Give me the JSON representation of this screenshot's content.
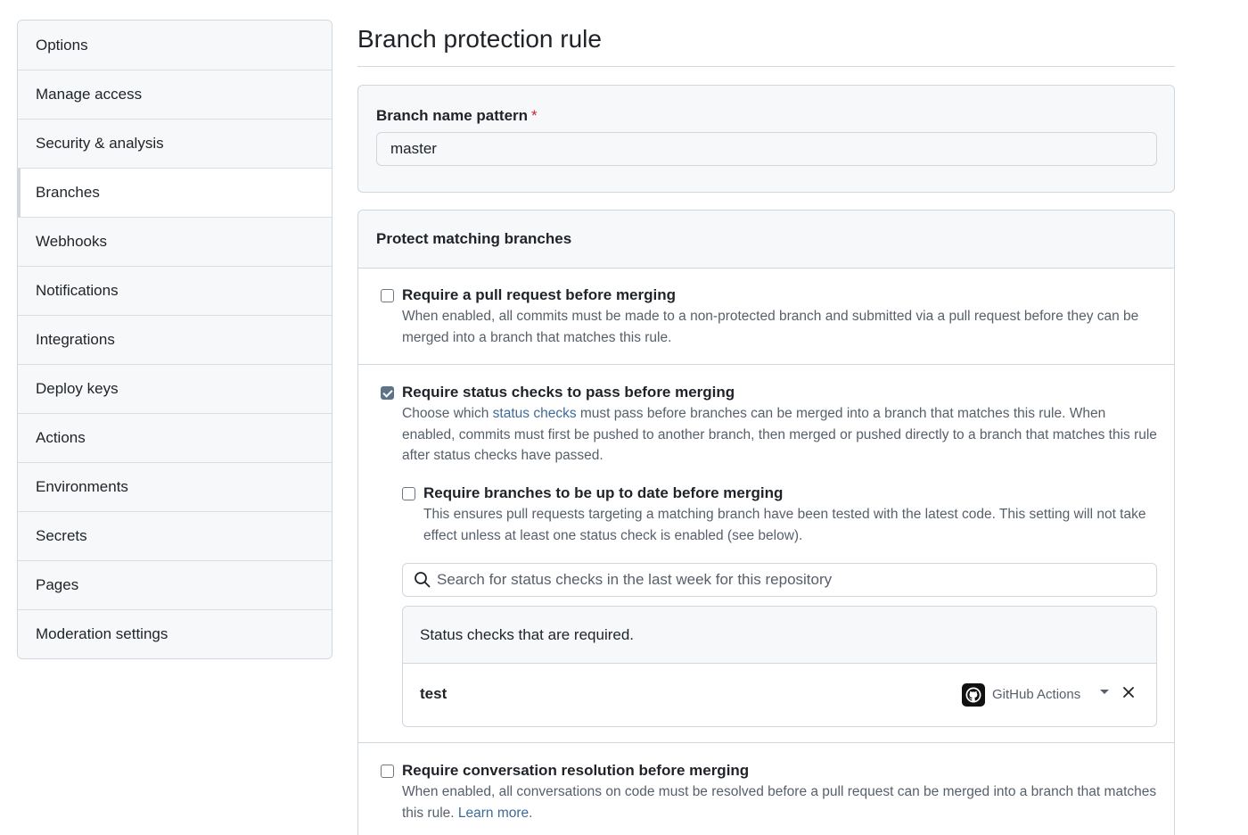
{
  "sidebar": {
    "items": [
      {
        "label": "Options"
      },
      {
        "label": "Manage access"
      },
      {
        "label": "Security & analysis"
      },
      {
        "label": "Branches"
      },
      {
        "label": "Webhooks"
      },
      {
        "label": "Notifications"
      },
      {
        "label": "Integrations"
      },
      {
        "label": "Deploy keys"
      },
      {
        "label": "Actions"
      },
      {
        "label": "Environments"
      },
      {
        "label": "Secrets"
      },
      {
        "label": "Pages"
      },
      {
        "label": "Moderation settings"
      }
    ],
    "active": "Branches"
  },
  "page": {
    "title": "Branch protection rule"
  },
  "pattern": {
    "label": "Branch name pattern",
    "required_mark": "*",
    "value": "master"
  },
  "protect": {
    "heading": "Protect matching branches",
    "rules": {
      "pull_request": {
        "checked": false,
        "title": "Require a pull request before merging",
        "desc": "When enabled, all commits must be made to a non-protected branch and submitted via a pull request before they can be merged into a branch that matches this rule."
      },
      "status_checks": {
        "checked": true,
        "title": "Require status checks to pass before merging",
        "desc_before": "Choose which ",
        "desc_link": "status checks",
        "desc_after": " must pass before branches can be merged into a branch that matches this rule. When enabled, commits must first be pushed to another branch, then merged or pushed directly to a branch that matches this rule after status checks have passed."
      },
      "up_to_date": {
        "checked": false,
        "title": "Require branches to be up to date before merging",
        "desc": "This ensures pull requests targeting a matching branch have been tested with the latest code. This setting will not take effect unless at least one status check is enabled (see below)."
      },
      "conversation": {
        "checked": false,
        "title": "Require conversation resolution before merging",
        "desc_before": "When enabled, all conversations on code must be resolved before a pull request can be merged into a branch that matches this rule. ",
        "desc_link": "Learn more",
        "desc_after": "."
      }
    },
    "search": {
      "placeholder": "Search for status checks in the last week for this repository"
    },
    "required_checks": {
      "heading": "Status checks that are required.",
      "items": [
        {
          "name": "test",
          "app": "GitHub Actions"
        }
      ]
    }
  },
  "colors": {
    "border": "#d0d7de",
    "muted_text": "#57606a",
    "link": "#3e6b98",
    "checkbox_checked": "#5e7387",
    "required_star": "#cf222e"
  }
}
